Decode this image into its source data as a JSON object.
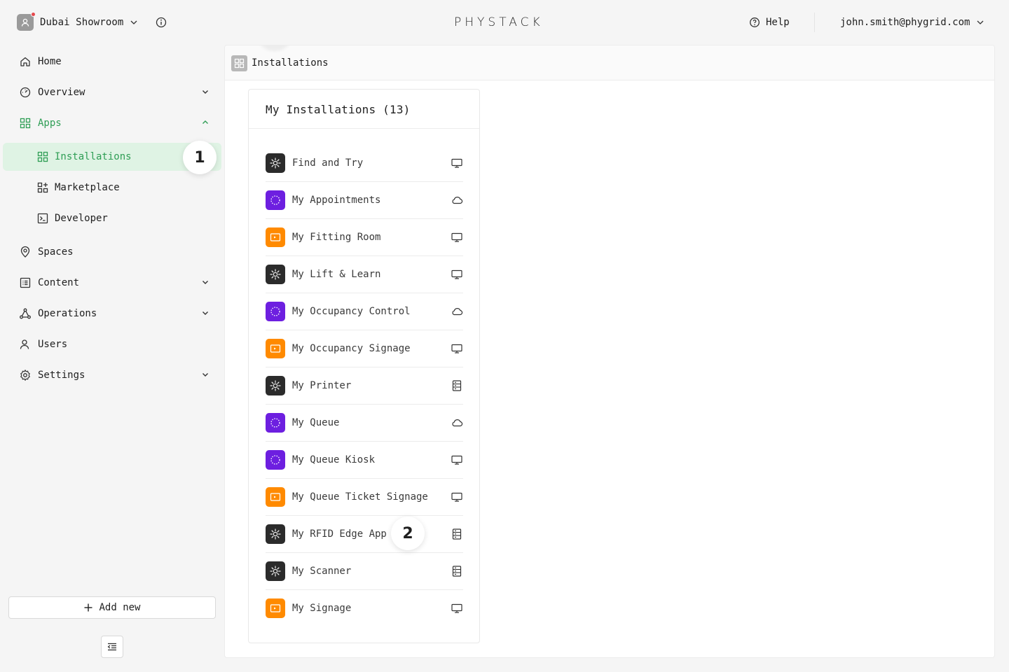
{
  "header": {
    "org_name": "Dubai Showroom",
    "logo_text": "PHYSTACK",
    "help_label": "Help",
    "user_email": "john.smith@phygrid.com"
  },
  "sidebar": {
    "items": [
      {
        "label": "Home",
        "icon": "home-icon"
      },
      {
        "label": "Overview",
        "icon": "gauge-icon",
        "chevron": "down"
      },
      {
        "label": "Apps",
        "icon": "grid-icon",
        "chevron": "up",
        "expanded": true
      },
      {
        "label": "Installations",
        "icon": "grid-icon",
        "active": true
      },
      {
        "label": "Marketplace",
        "icon": "grid-plus-icon"
      },
      {
        "label": "Developer",
        "icon": "terminal-icon"
      },
      {
        "label": "Spaces",
        "icon": "map-pin-icon"
      },
      {
        "label": "Content",
        "icon": "list-icon",
        "chevron": "down"
      },
      {
        "label": "Operations",
        "icon": "network-icon",
        "chevron": "down"
      },
      {
        "label": "Users",
        "icon": "user-icon"
      },
      {
        "label": "Settings",
        "icon": "gear-icon",
        "chevron": "down"
      }
    ],
    "add_new_label": "Add new"
  },
  "main": {
    "title": "Installations",
    "card_title": "My Installations (13)",
    "installations": [
      {
        "name": "Find and Try",
        "icon_color": "#2b2b2b",
        "type": "device"
      },
      {
        "name": "My Appointments",
        "icon_color": "#6d1fe0",
        "type": "cloud"
      },
      {
        "name": "My Fitting Room",
        "icon_color": "#ff8a00",
        "type": "device"
      },
      {
        "name": "My Lift & Learn",
        "icon_color": "#2b2b2b",
        "type": "device"
      },
      {
        "name": "My Occupancy Control",
        "icon_color": "#6d1fe0",
        "type": "cloud"
      },
      {
        "name": "My Occupancy Signage",
        "icon_color": "#ff8a00",
        "type": "device"
      },
      {
        "name": "My Printer",
        "icon_color": "#2b2b2b",
        "type": "edge"
      },
      {
        "name": "My Queue",
        "icon_color": "#6d1fe0",
        "type": "cloud"
      },
      {
        "name": "My Queue Kiosk",
        "icon_color": "#6d1fe0",
        "type": "device"
      },
      {
        "name": "My Queue Ticket Signage",
        "icon_color": "#ff8a00",
        "type": "device"
      },
      {
        "name": "My RFID Edge App",
        "icon_color": "#2b2b2b",
        "type": "edge"
      },
      {
        "name": "My Scanner",
        "icon_color": "#2b2b2b",
        "type": "edge"
      },
      {
        "name": "My Signage",
        "icon_color": "#ff8a00",
        "type": "device"
      }
    ]
  },
  "annotations": {
    "step1": "1",
    "step2": "2"
  },
  "colors": {
    "accent": "#2f9e55",
    "active_bg": "#dff3e4",
    "dark_app": "#2b2b2b",
    "purple_app": "#6d1fe0",
    "orange_app": "#ff8a00"
  }
}
